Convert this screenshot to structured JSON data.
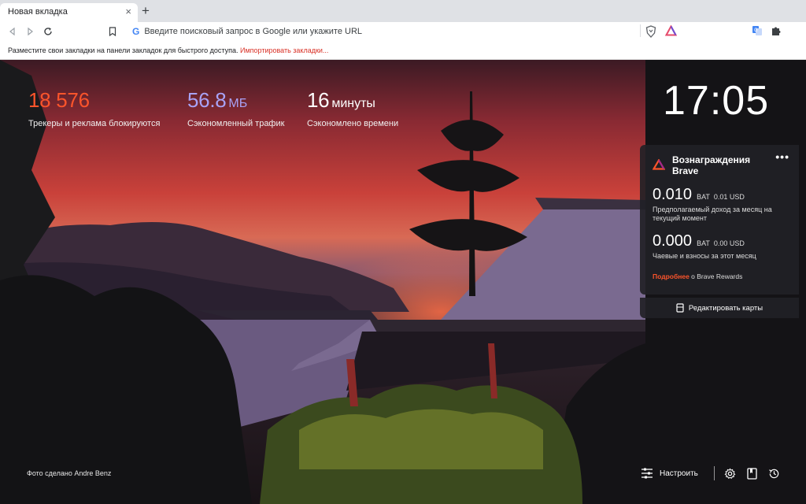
{
  "tab": {
    "title": "Новая вкладка",
    "close_glyph": "×",
    "new_tab_glyph": "+"
  },
  "toolbar": {
    "back_icon": "back-icon",
    "forward_icon": "forward-icon",
    "reload_icon": "reload-icon",
    "bookmark_icon": "bookmark-icon",
    "search_engine_icon": "G",
    "url_placeholder": "Введите поисковый запрос в Google или укажите URL",
    "url_value": "",
    "shield_icon": "brave-shield-icon",
    "rewards_icon": "brave-rewards-icon",
    "translate_icon": "translate-icon",
    "extensions_icon": "puzzle-icon"
  },
  "bookmarks_bar": {
    "text": "Разместите свои закладки на панели закладок для быстрого доступа. ",
    "import_link": "Импортировать закладки..."
  },
  "stats": [
    {
      "value": "18 576",
      "unit": "",
      "label": "Трекеры и реклама блокируются",
      "color": "#fb542b"
    },
    {
      "value": "56.8",
      "unit": "МБ",
      "label": "Сэкономленный трафик",
      "color": "#a8a2f5"
    },
    {
      "value": "16",
      "unit": "минуты",
      "label": "Сэкономлено времени",
      "color": "#ffffff"
    }
  ],
  "clock": "17:05",
  "rewards": {
    "title_line1": "Вознаграждения",
    "title_line2": "Brave",
    "menu_glyph": "•••",
    "estimated": {
      "amount": "0.010",
      "currency": "BAT",
      "usd": "0.01 USD",
      "description": "Предполагаемый доход за месяц на текущий момент"
    },
    "tips": {
      "amount": "0.000",
      "currency": "BAT",
      "usd": "0.00 USD",
      "description": "Чаевые и взносы за этот месяц"
    },
    "more_link": "Подробнее",
    "more_rest": " о Brave Rewards",
    "accent": "#fb542b"
  },
  "edit_cards": "Редактировать карты",
  "photo_credit": "Фото сделано Andre Benz",
  "bottom": {
    "customize_label": "Настроить",
    "settings_icon": "gear-icon",
    "bookmarks_icon": "bookmarks-icon",
    "history_icon": "history-icon"
  }
}
